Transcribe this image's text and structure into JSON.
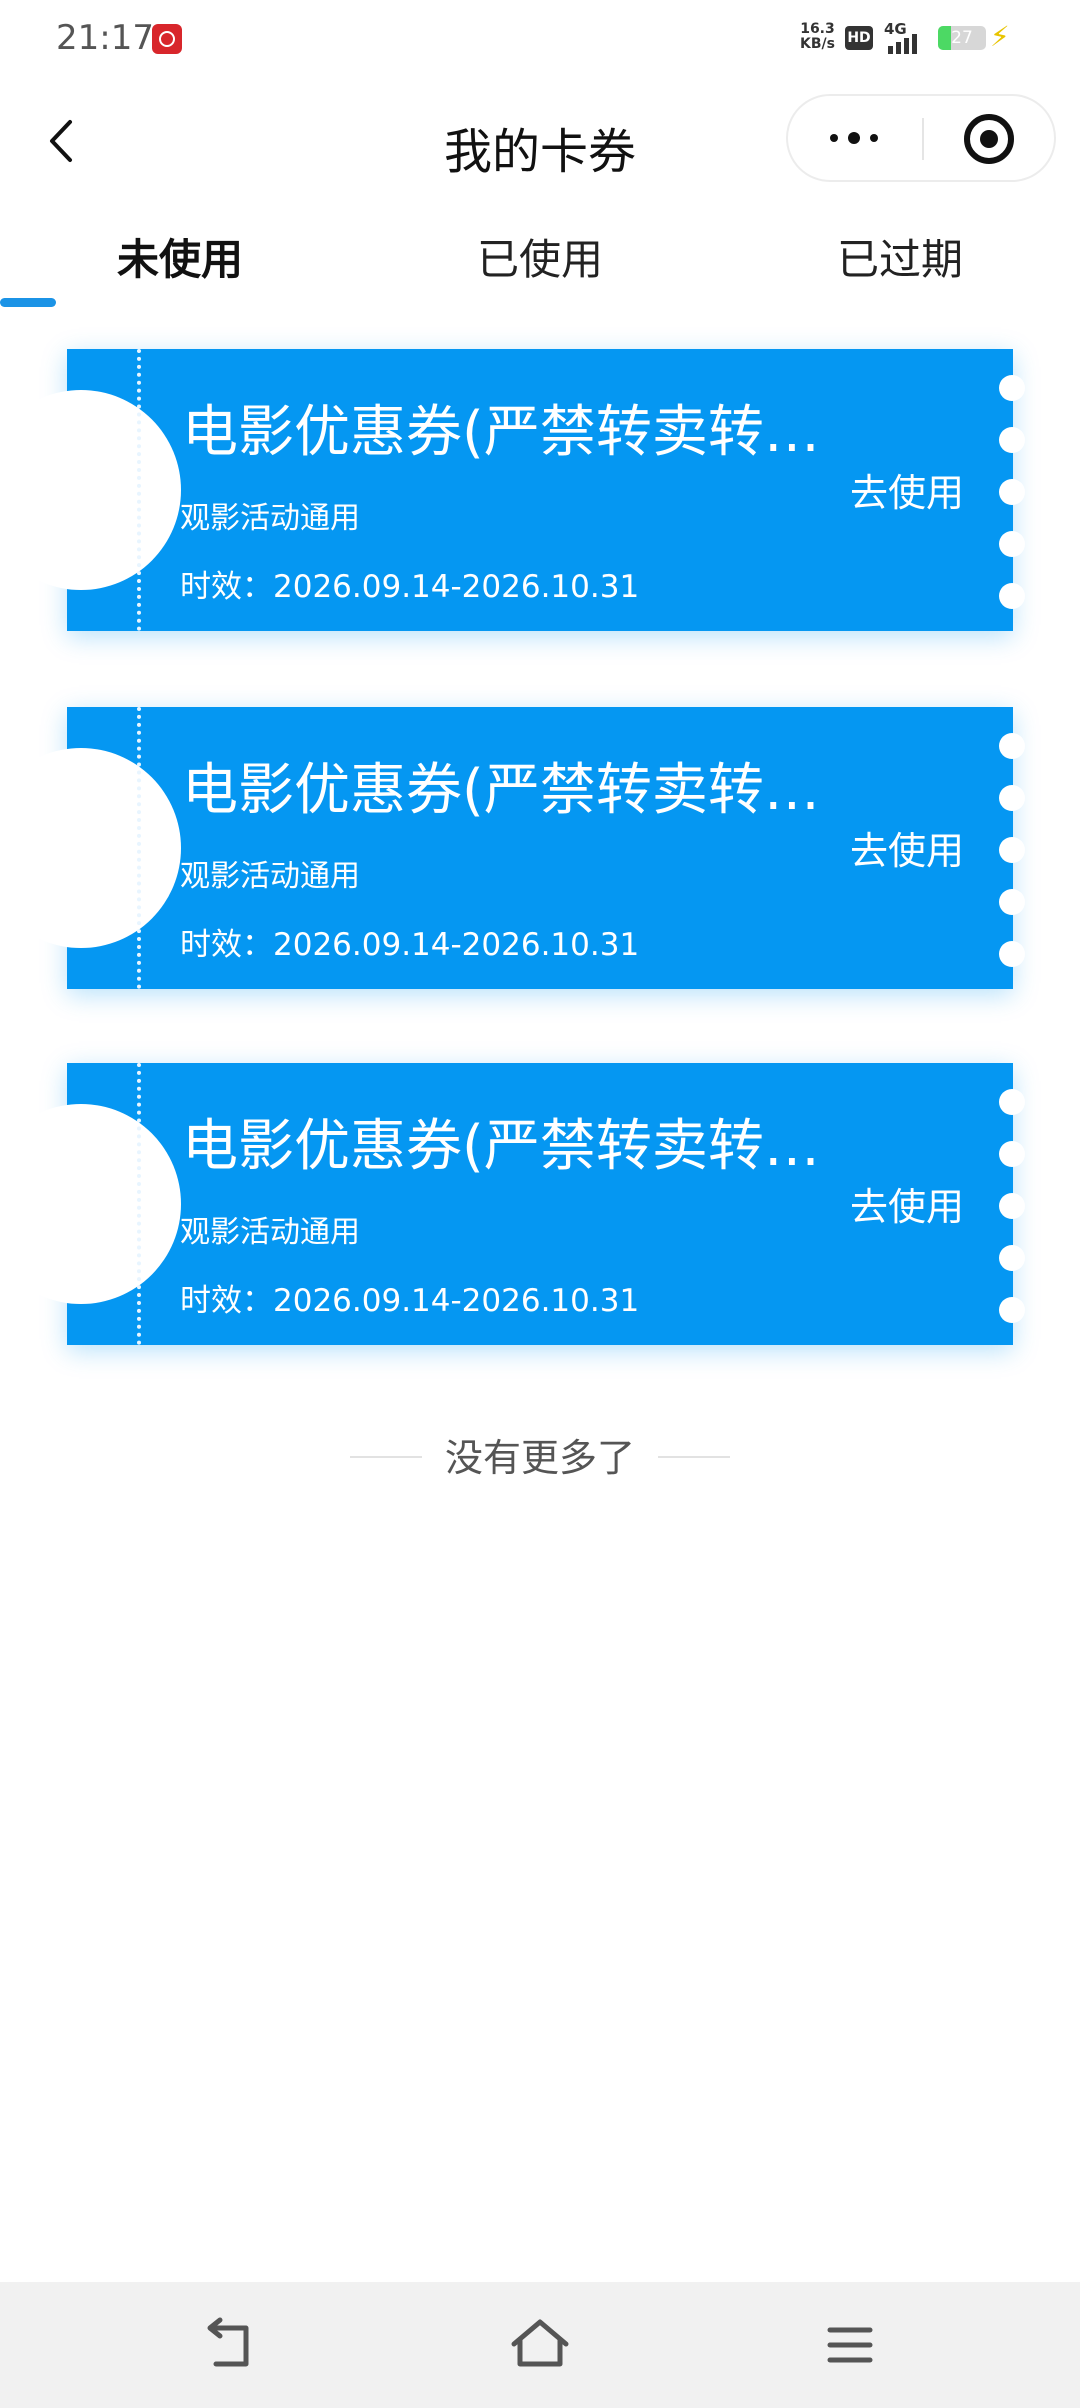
{
  "status_bar": {
    "time": "21:17",
    "net_speed_value": "16.3",
    "net_speed_unit": "KB/s",
    "hd_label": "HD",
    "network_label": "4G",
    "battery_level": "27",
    "battery_fraction": 0.27
  },
  "nav": {
    "title": "我的卡券"
  },
  "tabs": [
    {
      "label": "未使用"
    },
    {
      "label": "已使用"
    },
    {
      "label": "已过期"
    }
  ],
  "coupons": [
    {
      "title": "电影优惠券(严禁转卖转…",
      "subtitle": "观影活动通用",
      "validity": "时效：2026.09.14-2026.10.31",
      "action": "去使用"
    },
    {
      "title": "电影优惠券(严禁转卖转…",
      "subtitle": "观影活动通用",
      "validity": "时效：2026.09.14-2026.10.31",
      "action": "去使用"
    },
    {
      "title": "电影优惠券(严禁转卖转…",
      "subtitle": "观影活动通用",
      "validity": "时效：2026.09.14-2026.10.31",
      "action": "去使用"
    }
  ],
  "footer": {
    "no_more_text": "没有更多了"
  },
  "colors": {
    "coupon_blue": "#0597f2",
    "tab_indicator": "#1b93e6",
    "background": "#ffffff"
  },
  "icons": {
    "back": "chevron-left-icon",
    "more": "more-dots-icon",
    "close": "target-icon",
    "sys_back": "back-arrow-icon",
    "sys_home": "home-icon",
    "sys_menu": "menu-icon"
  }
}
